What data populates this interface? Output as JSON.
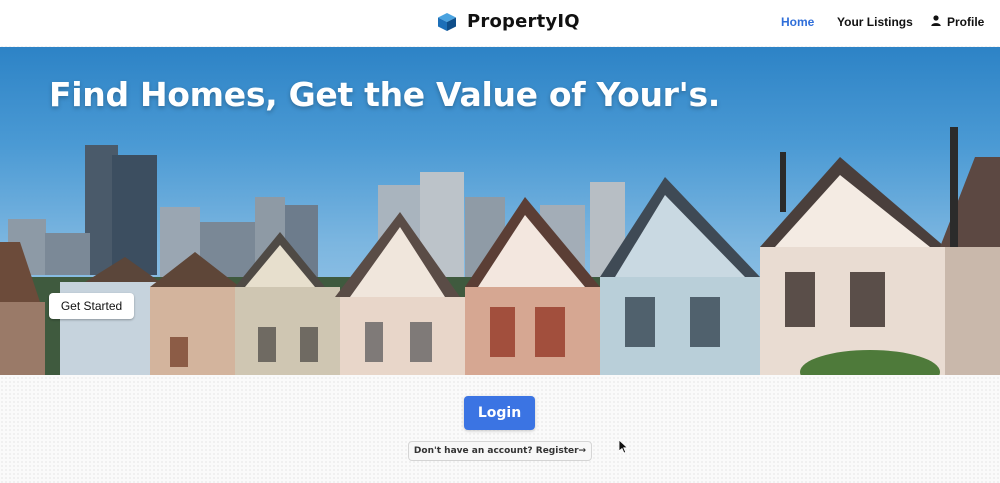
{
  "app": {
    "name": "PropertyIQ",
    "logo_icon": "cube-logo-icon",
    "brand_color": "#1d6fb8"
  },
  "nav": {
    "items": [
      {
        "label": "Home",
        "active": true,
        "color": "#2f6ed9"
      },
      {
        "label": "Your Listings",
        "active": false
      },
      {
        "label": "Profile",
        "active": false,
        "icon": "user-icon"
      }
    ]
  },
  "hero": {
    "title": "Find Homes, Get the Value of Your's.",
    "cta_label": "Get Started",
    "image": "row-of-victorian-houses-with-city-skyline"
  },
  "auth": {
    "login_label": "Login",
    "login_color": "#3b74e3",
    "register_label": "Don't have an account? Register→"
  }
}
